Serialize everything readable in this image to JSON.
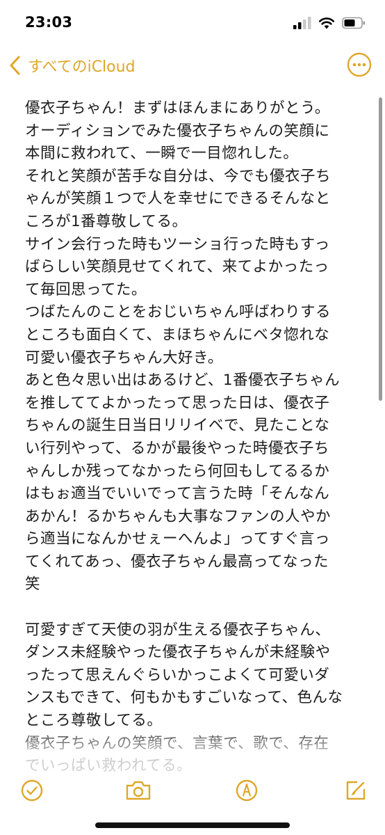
{
  "status_bar": {
    "time": "23:03"
  },
  "nav": {
    "back_label": "すべてのiCloud",
    "accent_color": "#e0a628"
  },
  "note": {
    "lines": [
      "優衣子ちゃん！まずはほんまにありがとう。",
      "オーディションでみた優衣子ちゃんの笑顔に",
      "本間に救われて、一瞬で一目惚れした。",
      "それと笑顔が苦手な自分は、今でも優衣子ち",
      "ゃんが笑顔１つで人を幸せにできるそんなと",
      "ころが1番尊敬してる。",
      "サイン会行った時もツーショ行った時もすっ",
      "ばらしい笑顔見せてくれて、来てよかったっ",
      "て毎回思ってた。",
      "つばたんのことをおじいちゃん呼ばわりする",
      "ところも面白くて、まほちゃんにベタ惚れな",
      "可愛い優衣子ちゃん大好き。",
      "あと色々思い出はあるけど、1番優衣子ちゃん",
      "を推しててよかったって思った日は、優衣子",
      "ちゃんの誕生日当日リリイベで、見たことな",
      "い行列やって、るかが最後やった時優衣子ち",
      "ゃんしか残ってなかったら何回もしてるるか",
      "はもぉ適当でいいでって言うた時「そんなん",
      "あかん！るかちゃんも大事なファンの人やか",
      "ら適当になんかせぇーへんよ」ってすぐ言っ",
      "てくれてあっ、優衣子ちゃん最高ってなった",
      "笑",
      "",
      "可愛すぎて天使の羽が生える優衣子ちゃん、",
      "ダンス未経験やった優衣子ちゃんが未経験や",
      "ったって思えんぐらいかっこよくて可愛いダ",
      "ンスもできて、何もかもすごいなって、色んな",
      "ところ尊敬してる。",
      "優衣子ちゃんの笑顔で、言葉で、歌で、存在",
      "でいっぱい救われてる。"
    ]
  },
  "toolbar": {
    "items": [
      "checklist-icon",
      "camera-icon",
      "markup-icon",
      "compose-icon"
    ]
  }
}
